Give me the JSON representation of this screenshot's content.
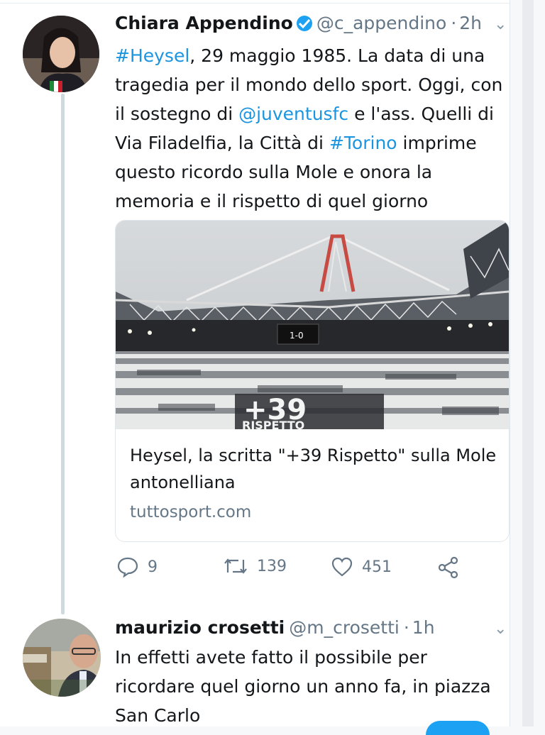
{
  "tweet1": {
    "name": "Chiara Appendino",
    "handle": "@c_appendino",
    "time": "2h",
    "dot": "·",
    "text": {
      "hashtag1": "#Heysel",
      "part1": ", 29 maggio 1985. La data di una tragedia per il mondo dello sport. Oggi, con il sostegno di ",
      "mention": "@juventusfc",
      "part2": " e  l'ass. Quelli di Via Filadelfia, la Città di ",
      "hashtag2": "#Torino",
      "part3": " imprime questo ricordo sulla Mole e onora la memoria e il rispetto di quel giorno"
    },
    "card": {
      "title": "Heysel, la scritta \"+39 Rispetto\" sulla Mole antonelliana",
      "domain": "tuttosport.com",
      "image_text_big": "+39",
      "image_text_small": "RISPETTO",
      "scoreboard": "1-0"
    },
    "actions": {
      "replies": "9",
      "retweets": "139",
      "likes": "451"
    }
  },
  "tweet2": {
    "name": "maurizio crosetti",
    "handle": "@m_crosetti",
    "time": "1h",
    "dot": "·",
    "text": "In effetti avete fatto il possibile per ricordare quel giorno un anno fa, in piazza San Carlo"
  },
  "colors": {
    "link": "#1b95e0",
    "secondary": "#657786",
    "verified": "#1da1f2"
  },
  "icons": [
    "verified-badge-icon",
    "chevron-down-icon",
    "reply-icon",
    "retweet-icon",
    "like-icon",
    "share-icon"
  ]
}
